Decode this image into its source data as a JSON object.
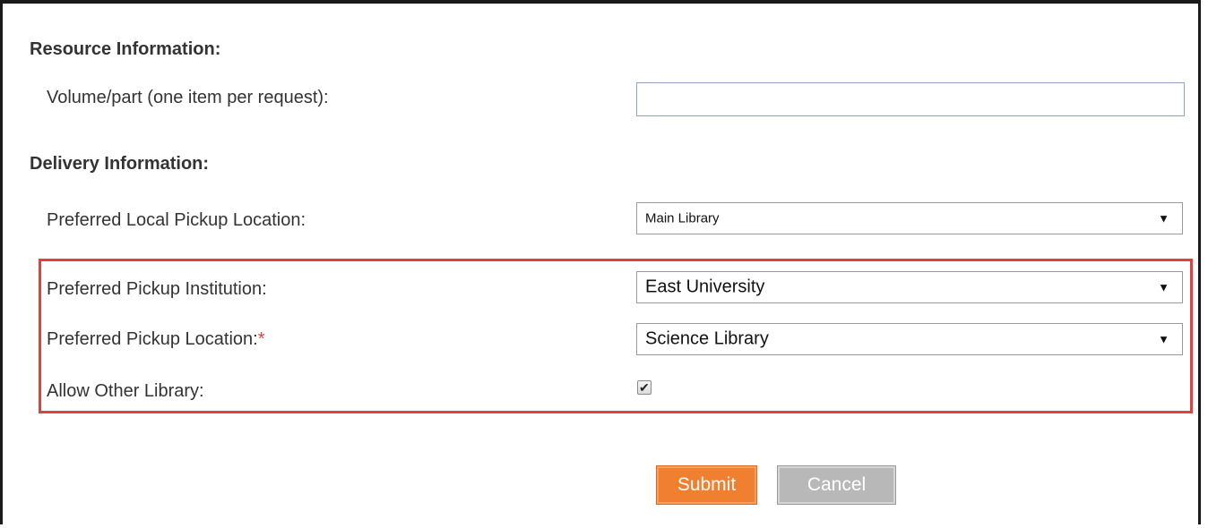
{
  "resource": {
    "title": "Resource Information:",
    "volume_label": "Volume/part (one item per request):",
    "volume_value": ""
  },
  "delivery": {
    "title": "Delivery Information:",
    "local_pickup_label": "Preferred Local Pickup Location:",
    "local_pickup_value": "Main Library",
    "institution_label": "Preferred Pickup Institution:",
    "institution_value": "East University",
    "location_label": "Preferred Pickup Location:",
    "location_required_mark": "*",
    "location_value": "Science Library",
    "allow_other_label": "Allow Other Library:",
    "allow_other_checked": true
  },
  "buttons": {
    "submit_label": "Submit",
    "cancel_label": "Cancel"
  },
  "colors": {
    "highlight": "#e0413a",
    "submit": "#f08030",
    "cancel": "#b8b8b8"
  },
  "icons": {
    "dropdown": "chevron-down-icon",
    "check": "checkmark-icon"
  }
}
